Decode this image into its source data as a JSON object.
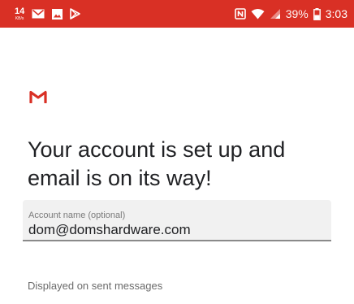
{
  "status_bar": {
    "network_speed_value": "14",
    "network_speed_unit": "KB/s",
    "notification_icons": [
      "mail-icon",
      "image-icon",
      "play-store-icon"
    ],
    "system_icons": [
      "nfc-icon",
      "wifi-icon",
      "signal-icon",
      "battery-icon"
    ],
    "battery_percent": "39%",
    "time": "3:03",
    "background_color": "#d93025"
  },
  "main": {
    "logo": "gmail-logo",
    "headline": "Your account is set up and email is on its way!",
    "account_name_field": {
      "label": "Account name (optional)",
      "value": "dom@domshardware.com"
    },
    "helper_text": "Displayed on sent messages"
  },
  "colors": {
    "gmail_red": "#d93025",
    "text_primary": "#202124",
    "field_background": "#f1f1f1"
  }
}
